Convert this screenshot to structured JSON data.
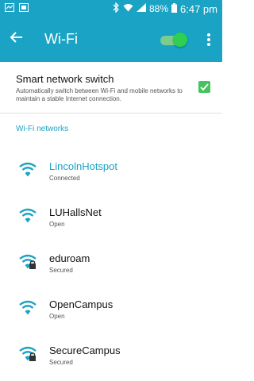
{
  "status_bar": {
    "battery": "88%",
    "time": "6:47 pm"
  },
  "app_bar": {
    "title": "Wi-Fi",
    "wifi_enabled": true
  },
  "smart_switch": {
    "title": "Smart network switch",
    "description": "Automatically switch between Wi-Fi and mobile networks to maintain a stable Internet connection.",
    "checked": true
  },
  "section": {
    "title": "Wi-Fi networks"
  },
  "networks": [
    {
      "name": "LincolnHotspot",
      "status": "Connected",
      "secured": false,
      "connected": true
    },
    {
      "name": "LUHallsNet",
      "status": "Open",
      "secured": false,
      "connected": false
    },
    {
      "name": "eduroam",
      "status": "Secured",
      "secured": true,
      "connected": false
    },
    {
      "name": "OpenCampus",
      "status": "Open",
      "secured": false,
      "connected": false
    },
    {
      "name": "SecureCampus",
      "status": "Secured",
      "secured": true,
      "connected": false
    }
  ],
  "colors": {
    "accent": "#1aa3c4",
    "toggle_on": "#2fcf52",
    "checkbox": "#46c35f"
  }
}
